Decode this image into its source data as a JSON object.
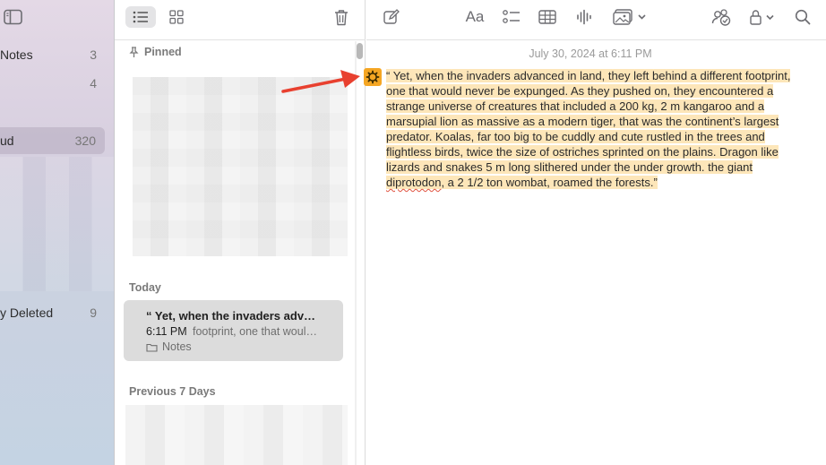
{
  "sidebar": {
    "items": [
      {
        "label": "Notes",
        "count": "3"
      },
      {
        "label": "",
        "count": "4"
      },
      {
        "label": "ud",
        "count": "320"
      },
      {
        "label": "y Deleted",
        "count": "9"
      }
    ]
  },
  "note_list": {
    "pinned_header": "Pinned",
    "today_header": "Today",
    "prev7_header": "Previous 7 Days",
    "note": {
      "title": "“ Yet, when the invaders adv…",
      "time": "6:11 PM",
      "snippet": "footprint, one that woul…",
      "folder": "Notes"
    }
  },
  "editor": {
    "date": "July 30, 2024 at 6:11 PM",
    "format_label": "Aa",
    "body_before_squiggle": "“ Yet, when the invaders advanced in land, they left behind a different footprint, one that would never be expunged. As they pushed on, they encountered a strange universe of creatures that included a 200 kg, 2 m kangaroo and a marsupial lion as massive as a modern tiger, that was the continent’s largest predator. Koalas, far too big to be cuddly and cute rustled in the trees and flightless birds, twice the size of ostriches sprinted on the plains. Dragon like lizards and snakes 5 m long slithered under the under growth. the giant ",
    "body_squiggle": "diprotodon",
    "body_after_squiggle": ", a 2 1/2 ton wombat, roamed the forests.”"
  },
  "colors": {
    "highlight": "#fde6b9",
    "marker": "#f5a623",
    "arrow": "#e8402f"
  }
}
